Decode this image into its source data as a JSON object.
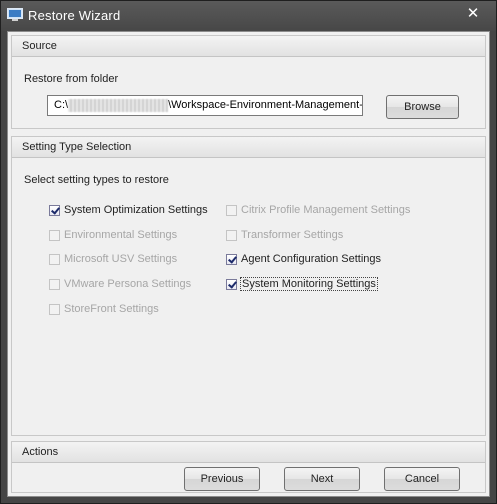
{
  "window": {
    "title": "Restore Wizard",
    "close_glyph": "✕"
  },
  "source": {
    "header": "Source",
    "folder_label": "Restore from folder",
    "path_prefix": "C:\\",
    "path_suffix": "\\Workspace-Environment-Management-v",
    "browse_label": "Browse"
  },
  "settings": {
    "header": "Setting Type Selection",
    "prompt": "Select setting types to restore",
    "left": [
      {
        "label": "System Optimization Settings",
        "checked": true,
        "enabled": true
      },
      {
        "label": "Environmental Settings",
        "checked": false,
        "enabled": false
      },
      {
        "label": "Microsoft USV Settings",
        "checked": false,
        "enabled": false
      },
      {
        "label": "VMware Persona Settings",
        "checked": false,
        "enabled": false
      },
      {
        "label": "StoreFront Settings",
        "checked": false,
        "enabled": false
      }
    ],
    "right": [
      {
        "label": "Citrix Profile Management Settings",
        "checked": false,
        "enabled": false
      },
      {
        "label": "Transformer Settings",
        "checked": false,
        "enabled": false
      },
      {
        "label": "Agent Configuration Settings",
        "checked": true,
        "enabled": true
      },
      {
        "label": "System Monitoring Settings",
        "checked": true,
        "enabled": true,
        "focused": true
      }
    ]
  },
  "actions": {
    "header": "Actions",
    "previous_label": "Previous",
    "next_label": "Next",
    "cancel_label": "Cancel"
  }
}
